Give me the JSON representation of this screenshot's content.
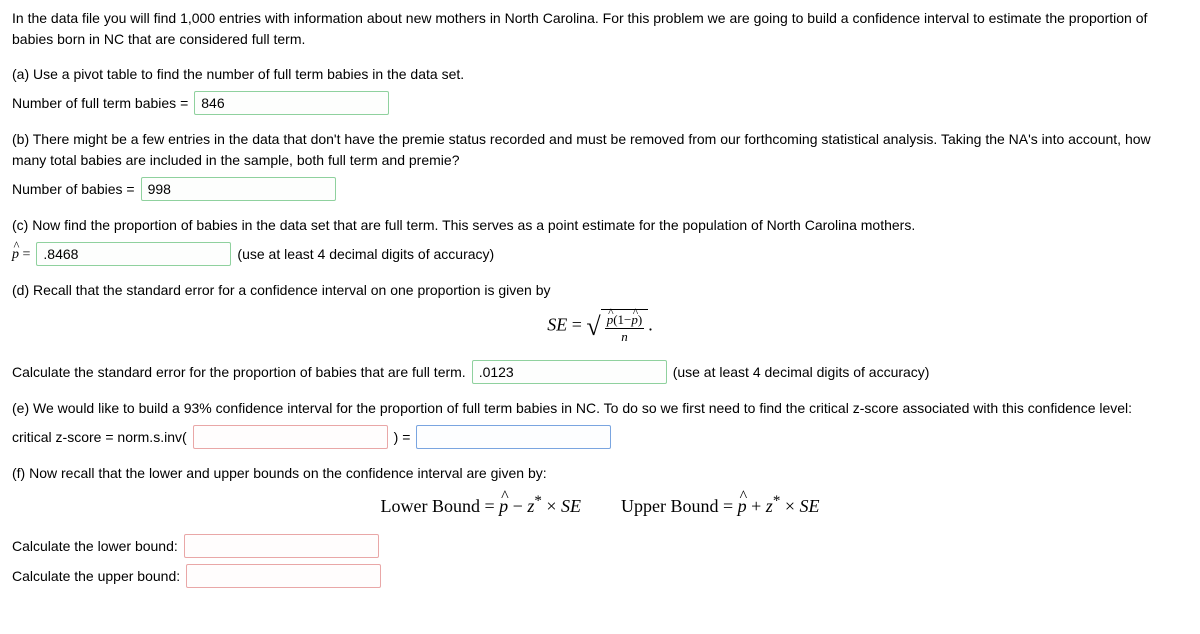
{
  "intro": "In the data file you will find 1,000 entries with information about new mothers in North Carolina. For this problem we are going to build a confidence interval to estimate the proportion of babies born in NC that are considered full term.",
  "a": {
    "question": "(a) Use a pivot table to find the number of full term babies in the data set.",
    "label": "Number of full term babies = ",
    "value": "846"
  },
  "b": {
    "question": "(b) There might be a few entries in the data that don't have the premie status recorded and must be removed from our forthcoming statistical analysis. Taking the NA's into account, how many total babies are included in the sample, both full term and premie?",
    "label": "Number of babies = ",
    "value": "998"
  },
  "c": {
    "question": "(c) Now find the proportion of babies in the data set that are full term. This serves as a point estimate for the population of North Carolina mothers.",
    "value": ".8468",
    "hint": "(use at least 4 decimal digits of accuracy)"
  },
  "d": {
    "question": "(d) Recall that the standard error for a confidence interval on one proportion is given by",
    "calc_label": "Calculate the standard error for the proportion of babies that are full term.",
    "value": ".0123",
    "hint": "(use at least 4 decimal digits of accuracy)"
  },
  "e": {
    "question": "(e) We would like to build a 93% confidence interval for the proportion of full term babies in NC. To do so we first need to find the critical z-score associated with this confidence level:",
    "label_pre": "critical z-score = norm.s.inv(",
    "label_mid": ") = "
  },
  "f": {
    "question": "(f) Now recall that the lower and upper bounds on the confidence interval are given by:",
    "lower_label": "Calculate the lower bound:",
    "upper_label": "Calculate the upper bound:",
    "lower_formula_label": "Lower Bound",
    "upper_formula_label": "Upper Bound"
  },
  "math": {
    "SE": "SE",
    "equals": " = ",
    "p_hat": "p",
    "one_minus_p": "(1−",
    "close_paren": ")",
    "n": "n",
    "minus": " − ",
    "plus": " + ",
    "z_star": "z",
    "star": "*",
    "times": " × "
  }
}
